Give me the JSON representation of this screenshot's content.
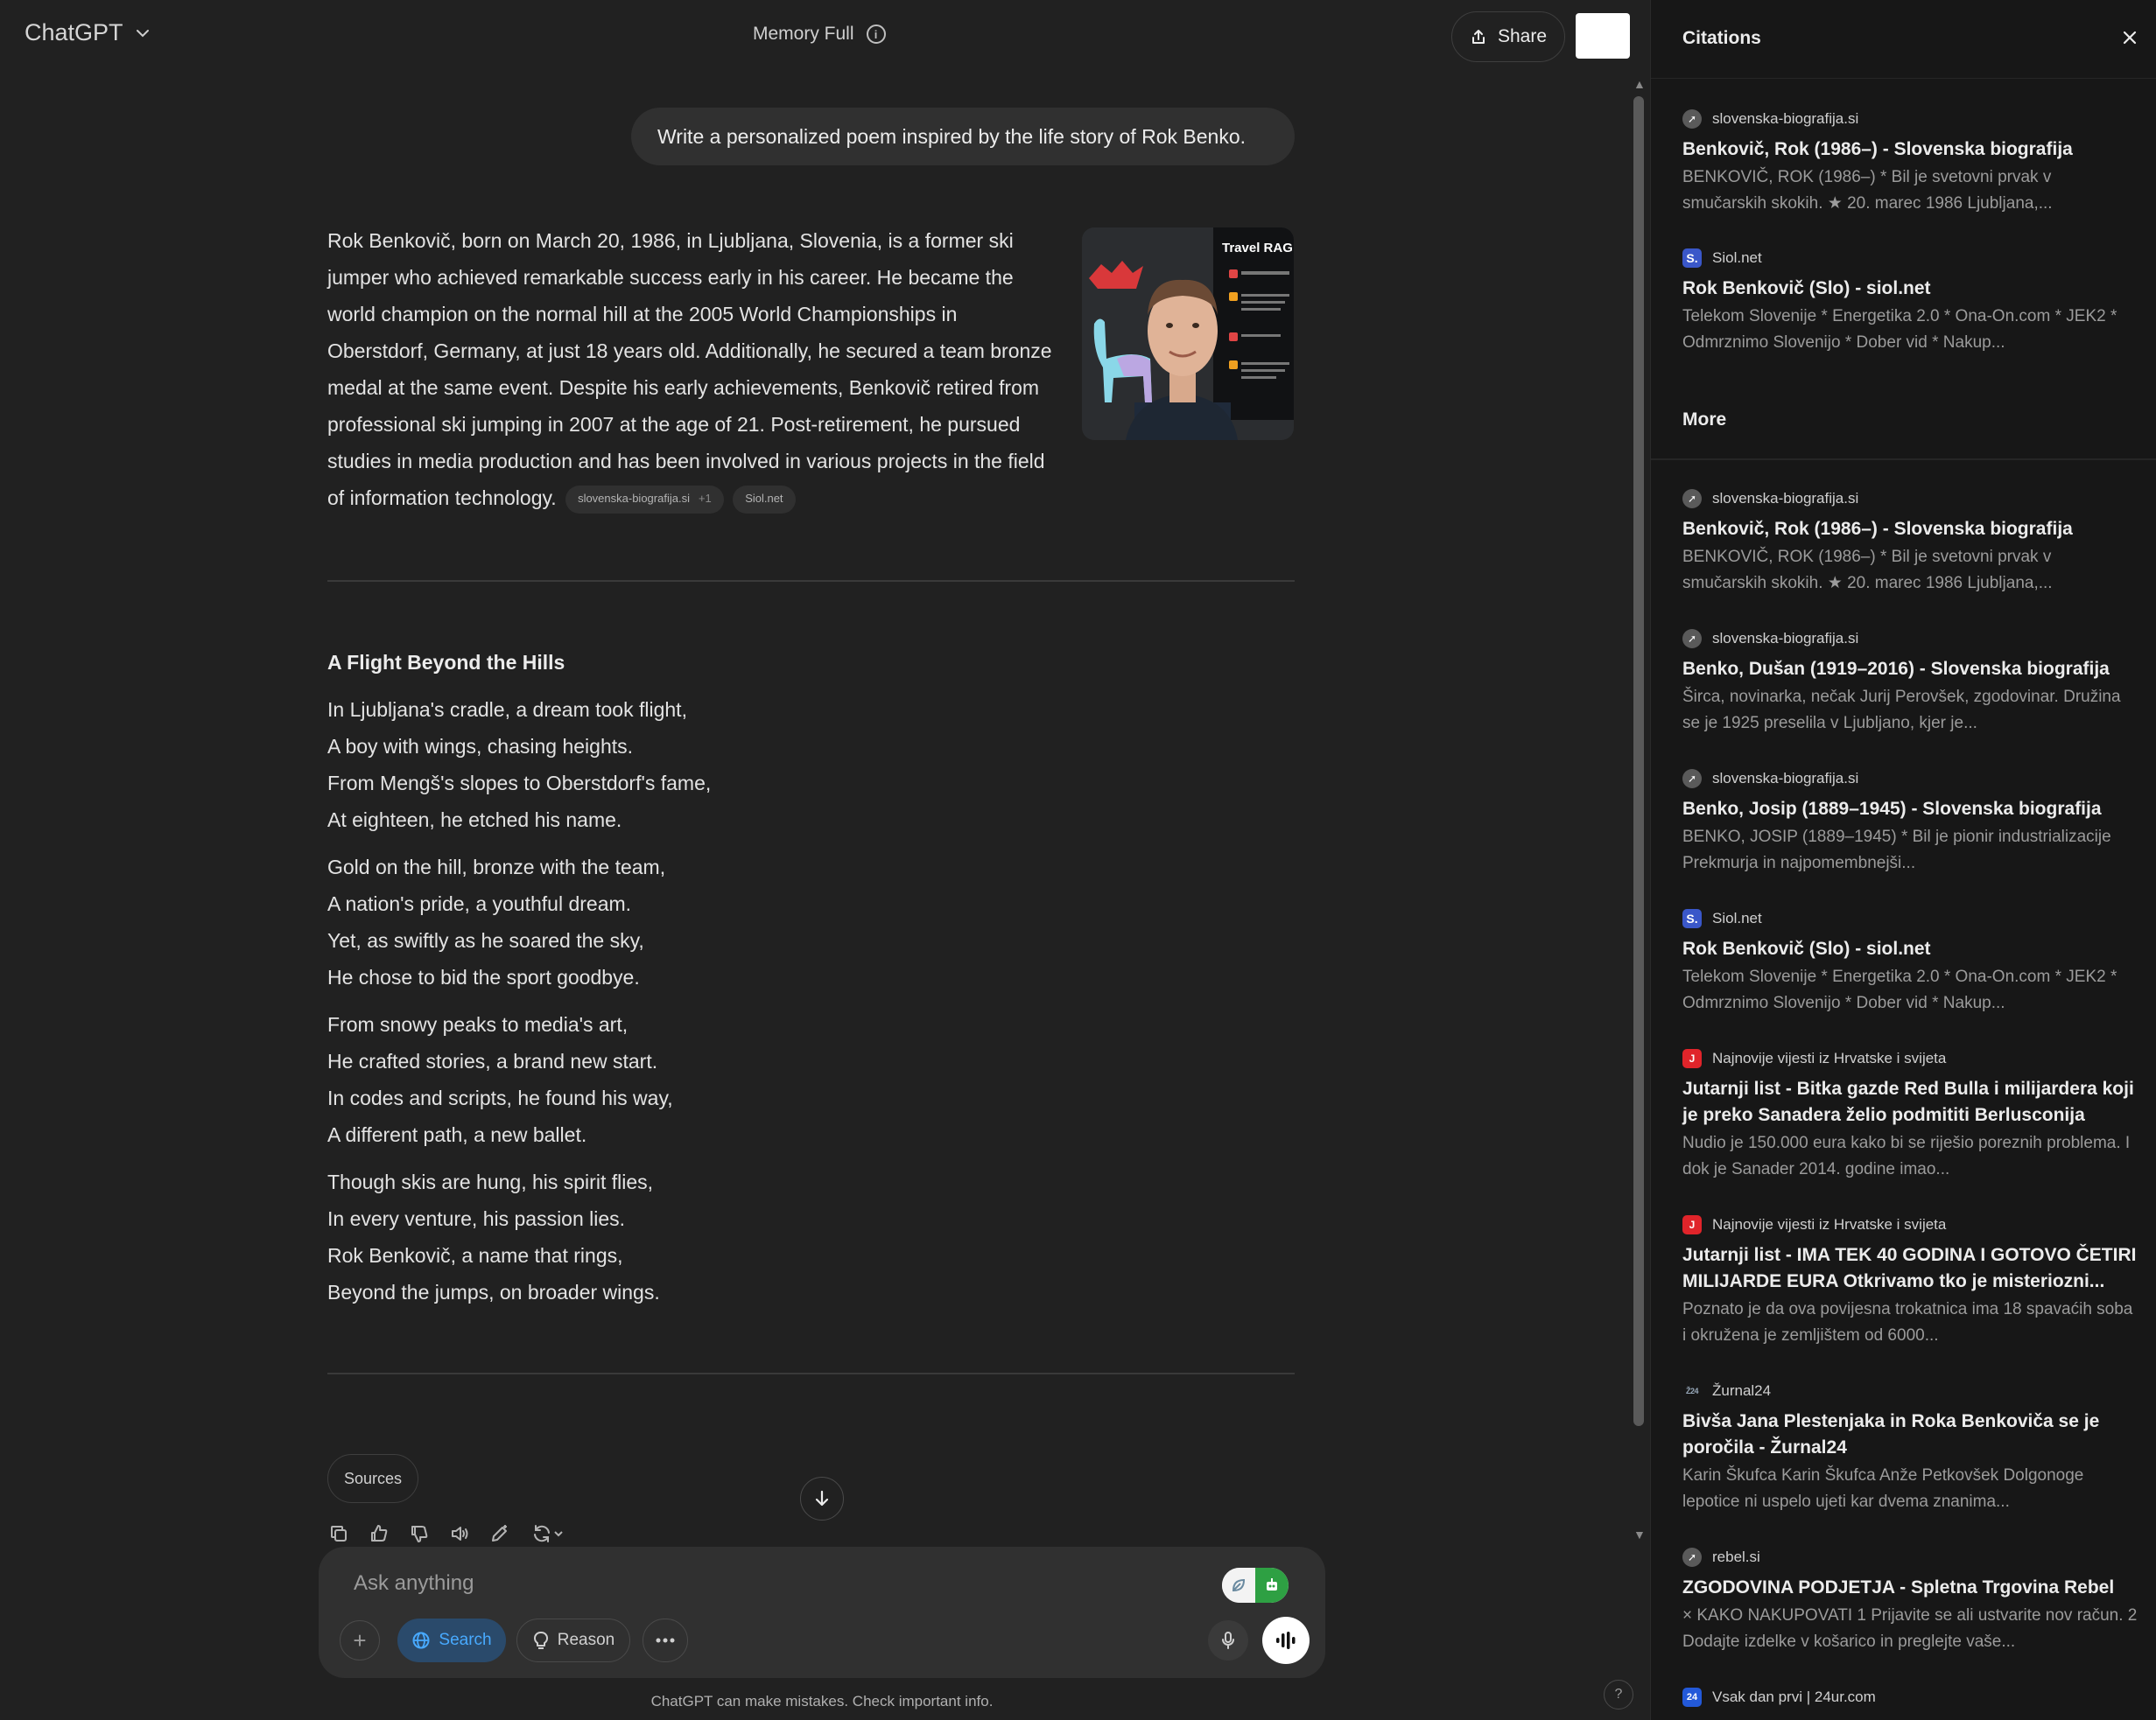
{
  "header": {
    "model_label": "ChatGPT",
    "memory_status": "Memory Full",
    "share_label": "Share"
  },
  "conversation": {
    "user_prompt": "Write a personalized poem inspired by the life story of Rok Benko.",
    "answer_text": "Rok Benkovič, born on March 20, 1986, in Ljubljana, Slovenia, is a former ski jumper who achieved remarkable success early in his career. He became the world champion on the normal hill at the 2005 World Championships in Oberstdorf, Germany, at just 18 years old. Additionally, he secured a team bronze medal at the same event. Despite his early achievements, Benkovič retired from professional ski jumping in 2007 at the age of 21. Post-retirement, he pursued studies in media production and has been involved in various projects in the field of information technology.",
    "source_chips": [
      {
        "label": "slovenska-biografija.si",
        "extra": "+1"
      },
      {
        "label": "Siol.net",
        "extra": ""
      }
    ],
    "thumbnail": {
      "overlay_title": "Travel RAG"
    },
    "poem": {
      "title": "A Flight Beyond the Hills",
      "stanzas": [
        [
          "In Ljubljana's cradle, a dream took flight,",
          "A boy with wings, chasing heights.",
          "From Mengš's slopes to Oberstdorf's fame,",
          "At eighteen, he etched his name."
        ],
        [
          "Gold on the hill, bronze with the team,",
          "A nation's pride, a youthful dream.",
          "Yet, as swiftly as he soared the sky,",
          "He chose to bid the sport goodbye."
        ],
        [
          "From snowy peaks to media's art,",
          "He crafted stories, a brand new start.",
          "In codes and scripts, he found his way,",
          "A different path, a new ballet."
        ],
        [
          "Though skis are hung, his spirit flies,",
          "In every venture, his passion lies.",
          "Rok Benkovič, a name that rings,",
          "Beyond the jumps, on broader wings."
        ]
      ]
    },
    "sources_label": "Sources"
  },
  "composer": {
    "placeholder": "Ask anything",
    "search_label": "Search",
    "reason_label": "Reason"
  },
  "footer": {
    "disclaimer": "ChatGPT can make mistakes. Check important info.",
    "help_label": "?"
  },
  "citations_panel": {
    "title": "Citations",
    "more_label": "More",
    "top": [
      {
        "site": "slovenska-biografija.si",
        "favicon": "compass-icon",
        "title": "Benkovič, Rok (1986–) - Slovenska biografija",
        "snippet": "BENKOVIČ, ROK (1986–) * Bil je svetovni prvak v smučarskih skokih. ★ 20. marec 1986 Ljubljana,..."
      },
      {
        "site": "Siol.net",
        "favicon": "siol-icon",
        "title": "Rok Benkovič (Slo) - siol.net",
        "snippet": "Telekom Slovenije * Energetika 2.0 * Ona-On.com * JEK2 * Odmrznimo Slovenijo * Dober vid * Nakup..."
      }
    ],
    "more": [
      {
        "site": "slovenska-biografija.si",
        "favicon": "compass-icon",
        "title": "Benkovič, Rok (1986–) - Slovenska biografija",
        "snippet": "BENKOVIČ, ROK (1986–) * Bil je svetovni prvak v smučarskih skokih. ★ 20. marec 1986 Ljubljana,..."
      },
      {
        "site": "slovenska-biografija.si",
        "favicon": "compass-icon",
        "title": "Benko, Dušan (1919–2016) - Slovenska biografija",
        "snippet": "Širca, novinarka, nečak Jurij Perovšek, zgodovinar. Družina se je 1925 preselila v Ljubljano, kjer je..."
      },
      {
        "site": "slovenska-biografija.si",
        "favicon": "compass-icon",
        "title": "Benko, Josip (1889–1945) - Slovenska biografija",
        "snippet": "BENKO, JOSIP (1889–1945) * Bil je pionir industrializacije Prekmurja in najpomembnejši..."
      },
      {
        "site": "Siol.net",
        "favicon": "siol-icon",
        "title": "Rok Benkovič (Slo) - siol.net",
        "snippet": "Telekom Slovenije * Energetika 2.0 * Ona-On.com * JEK2 * Odmrznimo Slovenijo * Dober vid * Nakup..."
      },
      {
        "site": "Najnovije vijesti iz Hrvatske i svijeta",
        "favicon": "jutarnji-icon",
        "title": "Jutarnji list - Bitka gazde Red Bulla i milijardera koji je preko Sanadera želio podmititi Berlusconija",
        "snippet": "Nudio je 150.000 eura kako bi se riješio poreznih problema. I dok je Sanader 2014. godine imao..."
      },
      {
        "site": "Najnovije vijesti iz Hrvatske i svijeta",
        "favicon": "jutarnji-icon",
        "title": "Jutarnji list - IMA TEK 40 GODINA I GOTOVO ČETIRI MILIJARDE EURA Otkrivamo tko je misteriozni...",
        "snippet": "Poznato je da ova povijesna trokatnica ima 18 spavaćih soba i okružena je zemljištem od 6000..."
      },
      {
        "site": "Žurnal24",
        "favicon": "zurnal24-icon",
        "title": "Bivša Jana Plestenjaka in Roka Benkoviča se je poročila - Žurnal24",
        "snippet": "Karin Škufca Karin Škufca Anže Petkovšek Dolgonoge lepotice ni uspelo ujeti kar dvema znanima..."
      },
      {
        "site": "rebel.si",
        "favicon": "compass-icon",
        "title": "ZGODOVINA PODJETJA - Spletna Trgovina Rebel",
        "snippet": "× KAKO NAKUPOVATI 1 Prijavite se ali ustvarite nov račun. 2 Dodajte izdelke v košarico in preglejte vaše..."
      },
      {
        "site": "Vsak dan prvi | 24ur.com",
        "favicon": "24ur-icon",
        "title": "",
        "snippet": ""
      }
    ]
  }
}
